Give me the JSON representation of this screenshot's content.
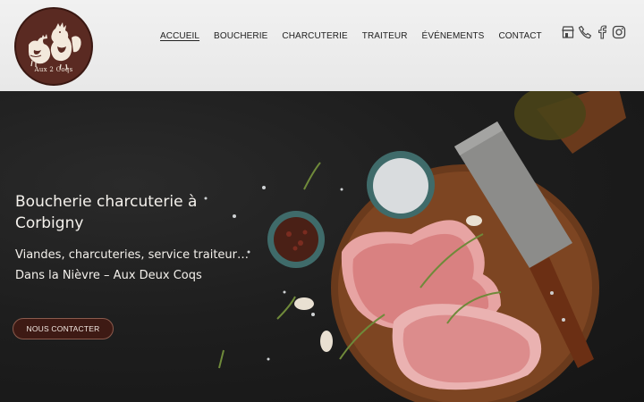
{
  "brand": {
    "logo_text": "Aux 2 Coqs"
  },
  "nav": {
    "items": [
      {
        "label": "ACCUEIL",
        "active": true
      },
      {
        "label": "BOUCHERIE",
        "active": false
      },
      {
        "label": "CHARCUTERIE",
        "active": false
      },
      {
        "label": "TRAITEUR",
        "active": false
      },
      {
        "label": "ÉVÉNEMENTS",
        "active": false
      },
      {
        "label": "CONTACT",
        "active": false
      }
    ]
  },
  "social_icons": [
    "store-icon",
    "phone-icon",
    "facebook-icon",
    "instagram-icon"
  ],
  "hero": {
    "title": "Boucherie charcuterie à Corbigny",
    "subtitle": "Viandes, charcuteries, service traiteur… Dans la Nièvre – Aux Deux Coqs",
    "cta_label": "NOUS CONTACTER"
  },
  "colors": {
    "header_bg": "#efefef",
    "logo_bg": "#5a2a22",
    "cta_bg": "#3e1a14",
    "hero_text": "#f4f1ec"
  }
}
